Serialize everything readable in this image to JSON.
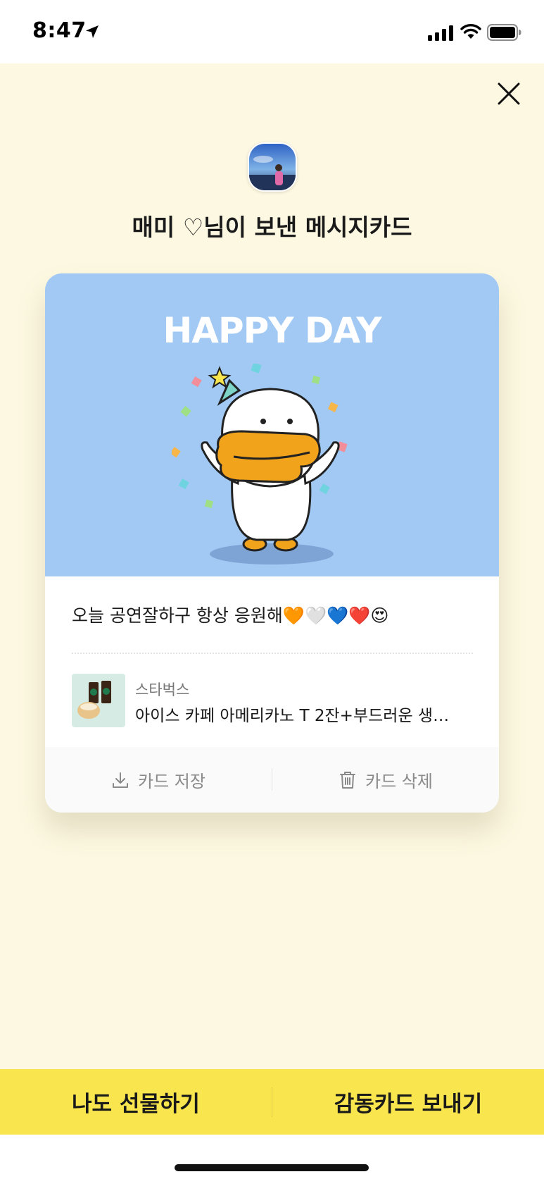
{
  "status_bar": {
    "time": "8:47",
    "icons": [
      "location-arrow-icon",
      "signal-bars-icon",
      "wifi-icon",
      "battery-icon"
    ]
  },
  "header": {
    "close_icon": "close-icon",
    "sender_title": "매미 ♡님이 보낸 메시지카드"
  },
  "card": {
    "image_text": "HAPPY DAY",
    "image_background": "#a1c9f4",
    "message": "오늘 공연잘하구 항상 응원해🧡🤍💙❤️😍",
    "gift": {
      "brand": "스타벅스",
      "name": "아이스 카페 아메리카노 T 2잔+부드러운 생…"
    },
    "actions": {
      "save_label": "카드 저장",
      "delete_label": "카드 삭제"
    }
  },
  "bottom_bar": {
    "left_label": "나도 선물하기",
    "right_label": "감동카드 보내기",
    "color": "#f9e54d"
  },
  "colors": {
    "screen_background": "#fdf8e1",
    "duck_beak": "#f2a31c"
  }
}
